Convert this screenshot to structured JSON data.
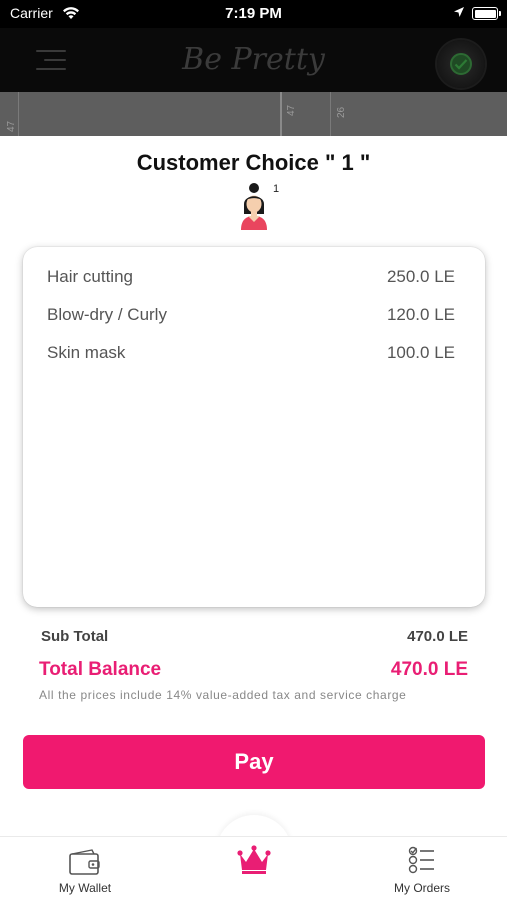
{
  "status_bar": {
    "carrier": "Carrier",
    "time": "7:19 PM"
  },
  "header": {
    "brand": "Be Pretty",
    "menu_icon": "hamburger-icon",
    "status_icon": "online-status-icon"
  },
  "map": {
    "streets": [
      "47",
      "47",
      "26"
    ]
  },
  "order": {
    "title": "Customer Choice \" 1 \"",
    "customer_count": "1",
    "avatar_icon": "woman-avatar-icon",
    "items": [
      {
        "name": "Hair cutting",
        "price": "250.0 LE"
      },
      {
        "name": "Blow-dry / Curly",
        "price": "120.0 LE"
      },
      {
        "name": "Skin mask",
        "price": "100.0 LE"
      }
    ]
  },
  "summary": {
    "subtotal_label": "Sub Total",
    "subtotal_value": "470.0 LE",
    "total_label": "Total Balance",
    "total_value": "470.0 LE",
    "tax_note": "All the prices include 14% value-added tax and service charge"
  },
  "actions": {
    "pay_label": "Pay"
  },
  "tabbar": {
    "wallet_label": "My Wallet",
    "orders_label": "My Orders",
    "center_icon": "crown-icon"
  },
  "colors": {
    "accent": "#f0196f",
    "total_text": "#e91e74",
    "header_bg": "#0a0a0a"
  }
}
